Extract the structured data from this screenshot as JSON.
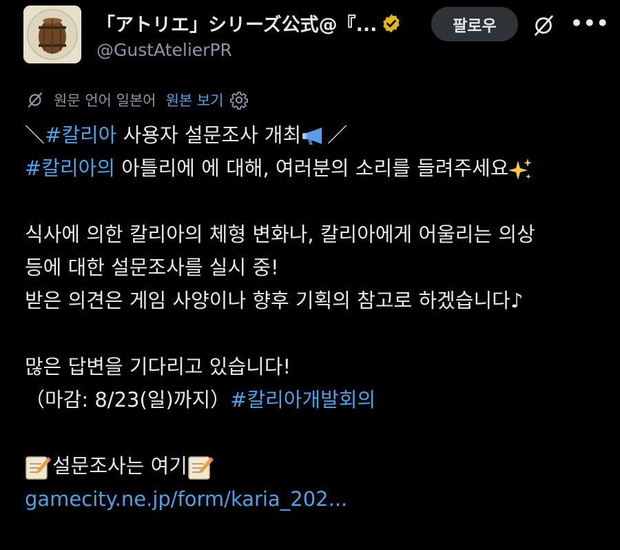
{
  "profile": {
    "display_name": "「アトリエ」シリーズ公式@『...",
    "handle": "@GustAtelierPR",
    "verified_color": "#e2b719"
  },
  "actions": {
    "follow_label": "팔로우",
    "more_label": "•••"
  },
  "translation": {
    "label": "원문 언어 일본어",
    "show_original": "원본 보기"
  },
  "post": {
    "line1_prefix": "＼",
    "line1_hashtag": "#칼리아",
    "line1_text": " 사용자 설문조사 개최",
    "line1_suffix": "／",
    "line2_hashtag": "#칼리아의",
    "line2_text": " 아틀리에 에 대해, 여러분의 소리를 들려주세요",
    "line3": "식사에 의한 칼리아의 체형 변화나, 칼리아에게 어울리는 의상",
    "line4": "등에 대한 설문조사를 실시 중!",
    "line5": "받은 의견은 게임 사양이나 향후 기획의 참고로 하겠습니다♪",
    "line6": "많은 답변을 기다리고 있습니다!",
    "line7_text": "（마감: 8/23(일)까지）",
    "line7_hashtag": "#칼리아개발회의",
    "line8_text": "설문조사는 여기",
    "link": "gamecity.ne.jp/form/karia_202..."
  },
  "icons": {
    "verified": "verified-badge-icon",
    "grok": "grok-icon",
    "more": "more-icon",
    "translate": "translate-icon",
    "gear": "gear-icon",
    "megaphone": "megaphone-icon",
    "sparkles": "sparkles-icon",
    "memo": "memo-icon"
  }
}
